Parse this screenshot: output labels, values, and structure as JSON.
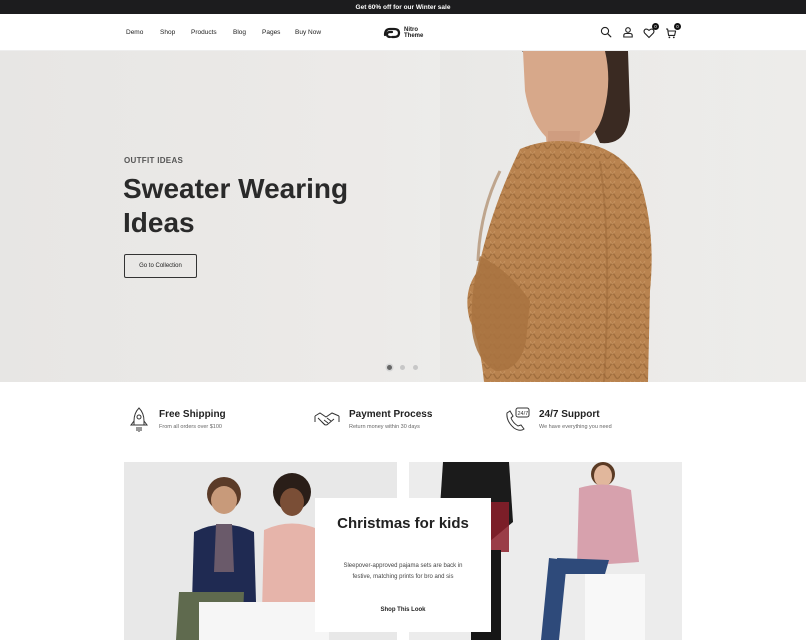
{
  "topbar": {
    "announcement": "Get 60% off for our Winter sale"
  },
  "nav": {
    "items": [
      "Demo",
      "Shop",
      "Products",
      "Blog",
      "Pages",
      "Buy Now"
    ]
  },
  "logo": {
    "line1": "Nitro",
    "line2": "Theme"
  },
  "header_icons": {
    "wishlist_count": "0",
    "cart_count": "0"
  },
  "hero": {
    "eyebrow": "OUTFIT IDEAS",
    "title": "Sweater Wearing Ideas",
    "button": "Go to Collection",
    "slides": 3,
    "active_slide": 1
  },
  "features": [
    {
      "icon": "rocket-icon",
      "title": "Free Shipping",
      "subtitle": "From all orders over $100"
    },
    {
      "icon": "handshake-icon",
      "title": "Payment Process",
      "subtitle": "Return money within 30 days"
    },
    {
      "icon": "phone-24-7-icon",
      "title": "24/7 Support",
      "subtitle": "We have everything you need"
    }
  ],
  "promo": {
    "title": "Christmas for kids",
    "text": "Sleepover-approved pajama sets are back in festive, matching prints for bro and sis",
    "link": "Shop This Look"
  },
  "colors": {
    "topbar": "#1c1c1e",
    "sweater": "#b9834f",
    "text": "#222222"
  }
}
